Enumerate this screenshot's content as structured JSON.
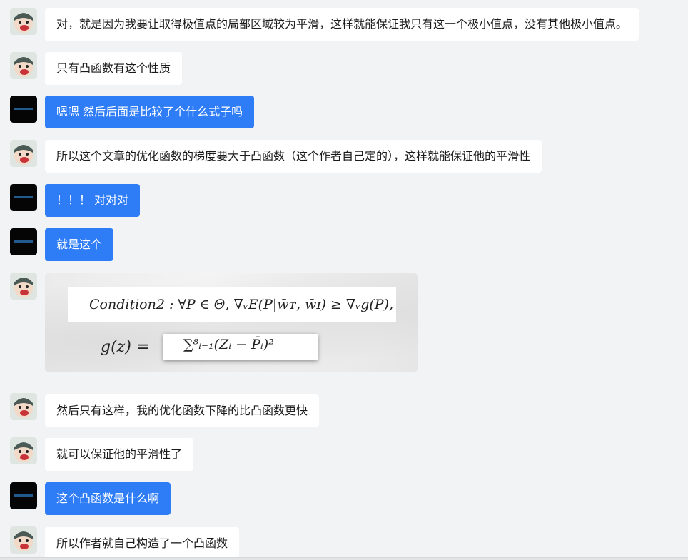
{
  "messages": [
    {
      "sender": "other",
      "text": "对，就是因为我要让取得极值点的局部区域较为平滑，这样就能保证我只有这一个极小值点，没有其他极小值点。"
    },
    {
      "sender": "other",
      "text": "只有凸函数有这个性质"
    },
    {
      "sender": "self",
      "text": "嗯嗯 然后后面是比较了个什么式子吗"
    },
    {
      "sender": "other",
      "text": "所以这个文章的优化函数的梯度要大于凸函数（这个作者自己定的），这样就能保证他的平滑性"
    },
    {
      "sender": "self",
      "text": "！！！ 对对对"
    },
    {
      "sender": "self",
      "text": "就是这个"
    },
    {
      "sender": "other",
      "type": "image",
      "formula_line1": "Condition2 : ∀P ∈ Θ, ∇ᵥE(P|w̄ᴛ, w̄ɪ) ≥ ∇ᵥg(P),",
      "formula_gz": "g(z) =",
      "formula_sum": "∑⁸ᵢ₌₁(Zᵢ − P̄ᵢ)²"
    },
    {
      "sender": "other",
      "text": "然后只有这样，我的优化函数下降的比凸函数更快"
    },
    {
      "sender": "other",
      "text": "就可以保证他的平滑性了"
    },
    {
      "sender": "self",
      "text": "这个凸函数是什么啊"
    },
    {
      "sender": "other",
      "text": "所以作者就自己构造了一个凸函数"
    }
  ],
  "colors": {
    "background": "#f2f3f5",
    "self_bubble": "#2e7cf6",
    "other_bubble": "#ffffff",
    "self_avatar": "#050505"
  },
  "icons": {
    "other_avatar": "cartoon-character-avatar",
    "self_avatar": "dark-avatar"
  }
}
